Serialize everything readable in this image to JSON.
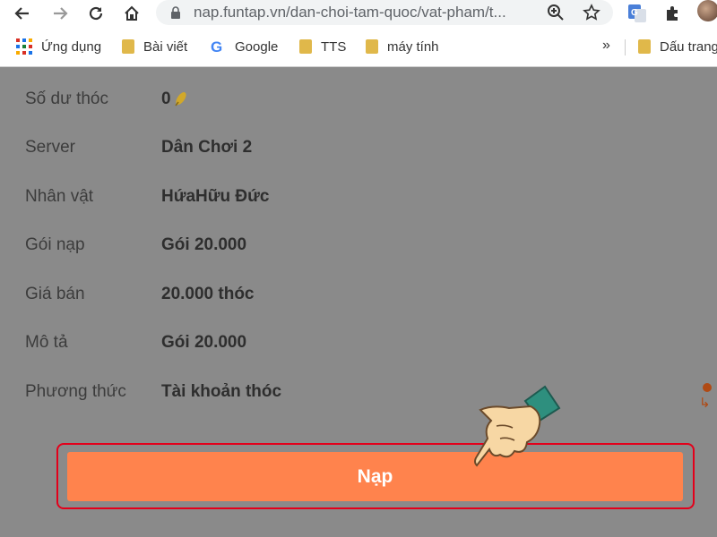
{
  "browser": {
    "url": "nap.funtap.vn/dan-choi-tam-quoc/vat-pham/t..."
  },
  "bookmarks": {
    "items": [
      {
        "label": "Ứng dụng",
        "icon": "apps-grid-icon"
      },
      {
        "label": "Bài viết",
        "icon": "folder-icon"
      },
      {
        "label": "Google",
        "icon": "google-icon"
      },
      {
        "label": "TTS",
        "icon": "folder-icon"
      },
      {
        "label": "máy tính",
        "icon": "folder-icon"
      }
    ],
    "more": "»",
    "overflow_item": {
      "label": "Dấu trang",
      "icon": "folder-icon"
    }
  },
  "details": {
    "rows": [
      {
        "label": "Số dư thóc",
        "value": "0"
      },
      {
        "label": "Server",
        "value": "Dân Chơi 2"
      },
      {
        "label": "Nhân vật",
        "value": "HứaHữu Đức"
      },
      {
        "label": "Gói nạp",
        "value": "Gói 20.000"
      },
      {
        "label": "Giá bán",
        "value": "20.000 thóc"
      },
      {
        "label": "Mô tả",
        "value": "Gói 20.000"
      },
      {
        "label": "Phương thức",
        "value": "Tài khoản thóc"
      }
    ]
  },
  "submit": {
    "label": "Nạp"
  },
  "colors": {
    "button": "#ff834d",
    "highlight_border": "#e3001b",
    "overlay": "#8a8a8a"
  }
}
